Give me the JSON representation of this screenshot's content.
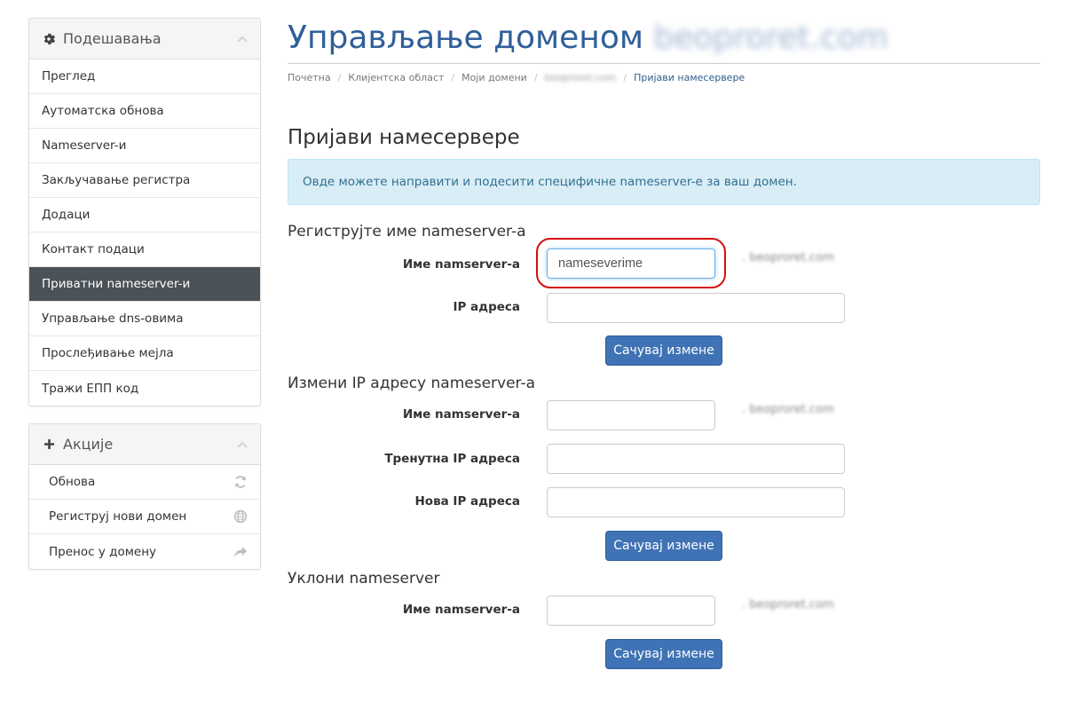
{
  "sidebar": {
    "settings_title": "Подешавања",
    "items": [
      {
        "label": "Преглед"
      },
      {
        "label": "Аутоматска обнова"
      },
      {
        "label": "Nameserver-и"
      },
      {
        "label": "Закључавање регистра"
      },
      {
        "label": "Додаци"
      },
      {
        "label": "Контакт подаци"
      },
      {
        "label": "Приватни nameserver-и",
        "active": true
      },
      {
        "label": "Управљање dns-овима"
      },
      {
        "label": "Прослеђивање мејла"
      },
      {
        "label": "Тражи ЕПП код"
      }
    ],
    "actions_title": "Акције",
    "actions": [
      {
        "label": "Обнова",
        "icon": "refresh-icon"
      },
      {
        "label": "Региструј нови домен",
        "icon": "globe-icon"
      },
      {
        "label": "Пренос у домену",
        "icon": "share-arrow-icon"
      }
    ]
  },
  "header": {
    "title": "Управљање доменом",
    "domain_blurred": "beoproret.com"
  },
  "breadcrumb": [
    "Почетна",
    "Клијентска област",
    "Моји домени",
    "beoproret.com",
    "Пријави намесервере"
  ],
  "page": {
    "section_title": "Пријави намесервере",
    "info_text": "Овде можете направити и подесити специфичне nameserver-е за ваш домен."
  },
  "register": {
    "title": "Региструјте име nameserver-а",
    "name_label": "Име namserver-а",
    "name_value": "nameseverime",
    "ip_label": "IP адреса",
    "ip_value": "",
    "domain_suffix": ". beoproret.com",
    "button": "Сачувај измене"
  },
  "modify": {
    "title": "Измени IP адресу nameserver-а",
    "name_label": "Име namserver-а",
    "current_ip_label": "Тренутна IP адреса",
    "new_ip_label": "Нова IP адреса",
    "domain_suffix": ". beoproret.com",
    "button": "Сачувај измене"
  },
  "remove": {
    "title": "Уклони nameserver",
    "name_label": "Име namserver-а",
    "domain_suffix": ". beoproret.com",
    "button": "Сачувај измене"
  },
  "colors": {
    "title_blue": "#2f5f9a",
    "button_blue": "#3f73b5",
    "active_menu": "#4a5157",
    "alert_bg": "#d9edf7",
    "highlight_red": "#d40d12"
  }
}
